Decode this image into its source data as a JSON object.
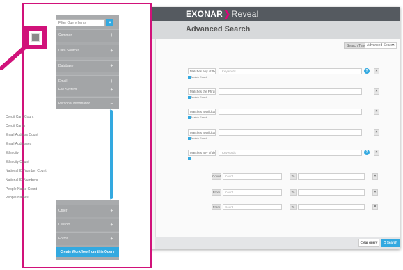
{
  "header": {
    "logo_bold": "EXONAR",
    "logo_sep": "❯",
    "logo_product": "Reveal",
    "page_title": "Advanced Search"
  },
  "search_type": {
    "label": "Search Type",
    "selected": "Advanced Search",
    "caret": "▼"
  },
  "text_rows": [
    {
      "field": "Matches any of the Words",
      "placeholder": "Keywords",
      "checkbox": "Match Exact",
      "help": "?",
      "remove": "×"
    },
    {
      "field": "Matches the Phrase",
      "placeholder": "",
      "checkbox": "Match Exact",
      "remove": "×"
    },
    {
      "field": "Matches a Wildcard*",
      "placeholder": "",
      "checkbox": "Match Exact",
      "remove": "×"
    },
    {
      "field": "Matches a Wildcard*",
      "placeholder": "",
      "checkbox": "Match Exact",
      "remove": "×"
    },
    {
      "field": "Matches any of the Words",
      "placeholder": "Keywords",
      "help": "?",
      "remove": "×"
    }
  ],
  "range_rows": [
    {
      "from_label": "Count",
      "from_placeholder": "Count",
      "to_label": "To",
      "remove": "×"
    },
    {
      "from_label": "From",
      "from_placeholder": "Count",
      "to_label": "To",
      "remove": "×"
    },
    {
      "from_label": "From",
      "from_placeholder": "Count",
      "to_label": "To",
      "remove": "×"
    }
  ],
  "footer": {
    "clear_label": "Clear query",
    "search_label": "Q Search"
  },
  "panel": {
    "filter_placeholder": "Filter Query Items",
    "filter_clear": "×",
    "categories_top": [
      {
        "label": "Common",
        "icon": "+"
      },
      {
        "label": "Data Sources",
        "icon": "+"
      },
      {
        "label": "Database",
        "icon": "+"
      },
      {
        "label": "Email",
        "icon": "+"
      },
      {
        "label": "File System",
        "icon": "+"
      },
      {
        "label": "Personal Information",
        "icon": "−"
      }
    ],
    "personal_items": [
      "Credit Card Count",
      "Credit Cards",
      "Email Address Count",
      "Email Addresses",
      "Ethnicity",
      "Ethnicity Count",
      "National ID Number Count",
      "National ID Numbers",
      "People Name Count",
      "People Names"
    ],
    "scroll_up": "▲",
    "scroll_down": "▼",
    "categories_bottom": [
      {
        "label": "Other",
        "icon": "+"
      },
      {
        "label": "Custom",
        "icon": "+"
      },
      {
        "label": "Forms",
        "icon": "+"
      }
    ],
    "workflow_label": "Create Workflow from this Query"
  },
  "colors": {
    "accent": "#33a9e0",
    "callout": "#d1127a",
    "header": "#555a60"
  }
}
